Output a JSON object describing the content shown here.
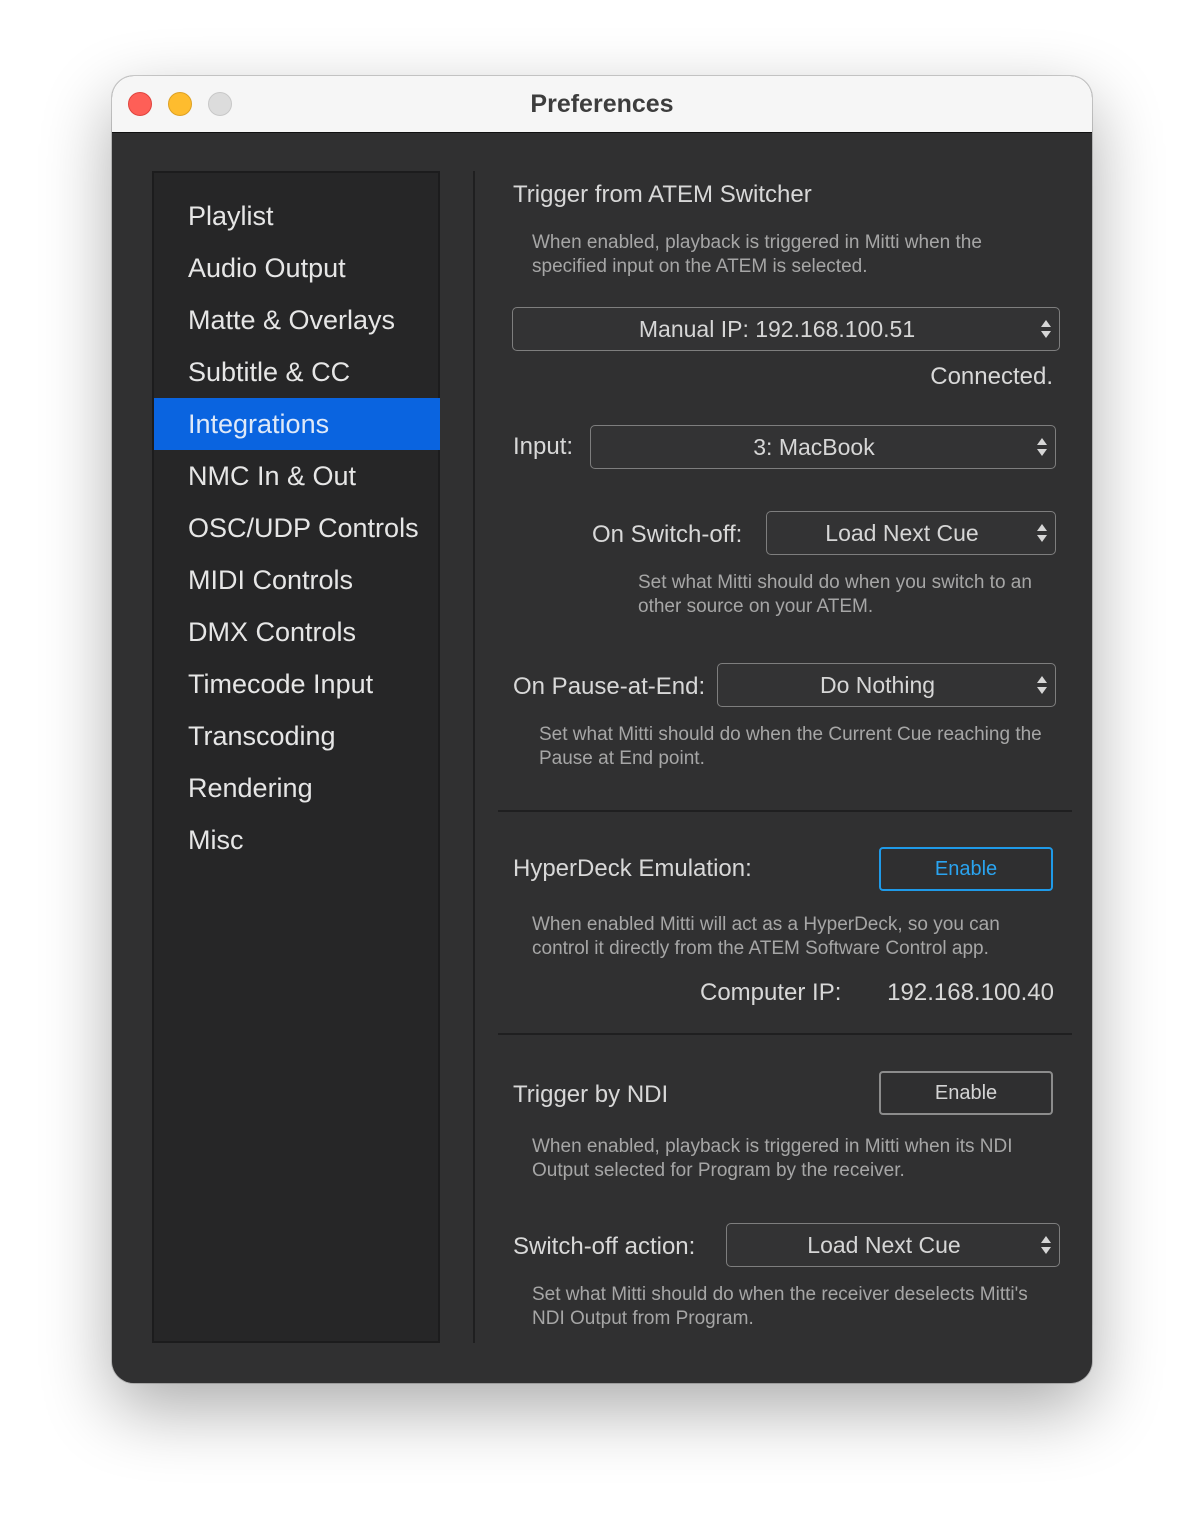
{
  "window": {
    "title": "Preferences",
    "controls": [
      "close",
      "minimize",
      "zoom"
    ]
  },
  "sidebar": {
    "items": [
      {
        "label": "Playlist"
      },
      {
        "label": "Audio Output"
      },
      {
        "label": "Matte & Overlays"
      },
      {
        "label": "Subtitle & CC"
      },
      {
        "label": "Integrations",
        "selected": true
      },
      {
        "label": "NMC In & Out"
      },
      {
        "label": "OSC/UDP Controls"
      },
      {
        "label": "MIDI Controls"
      },
      {
        "label": "DMX Controls"
      },
      {
        "label": "Timecode Input"
      },
      {
        "label": "Transcoding"
      },
      {
        "label": "Rendering"
      },
      {
        "label": "Misc"
      }
    ]
  },
  "atem": {
    "heading": "Trigger from ATEM Switcher",
    "description": "When enabled, playback is triggered in Mitti when the specified input on the ATEM is selected.",
    "connection_select": "Manual IP: 192.168.100.51",
    "status": "Connected.",
    "input_label": "Input:",
    "input_select": "3: MacBook",
    "switch_off_label": "On Switch-off:",
    "switch_off_select": "Load Next Cue",
    "switch_off_description": "Set what Mitti should do when you switch to an other source on your ATEM.",
    "pause_label": "On Pause-at-End:",
    "pause_select": "Do Nothing",
    "pause_description": "Set what Mitti should do when the Current Cue reaching the Pause at End point."
  },
  "hyperdeck": {
    "heading": "HyperDeck Emulation:",
    "button": "Enable",
    "description": "When enabled Mitti will act as a HyperDeck, so you can control it directly from the ATEM Software Control app.",
    "ip_label": "Computer IP:",
    "ip_value": "192.168.100.40"
  },
  "ndi": {
    "heading": "Trigger by NDI",
    "button": "Enable",
    "description": "When enabled, playback is triggered in Mitti when its NDI Output selected for Program by the receiver.",
    "switch_off_label": "Switch-off action:",
    "switch_off_select": "Load Next Cue",
    "switch_off_description": "Set what Mitti should do when the receiver deselects Mitti's NDI Output from Program."
  },
  "colors": {
    "selection": "#0a64e0",
    "focus_ring": "#1f9ae8",
    "background": "#303031"
  }
}
